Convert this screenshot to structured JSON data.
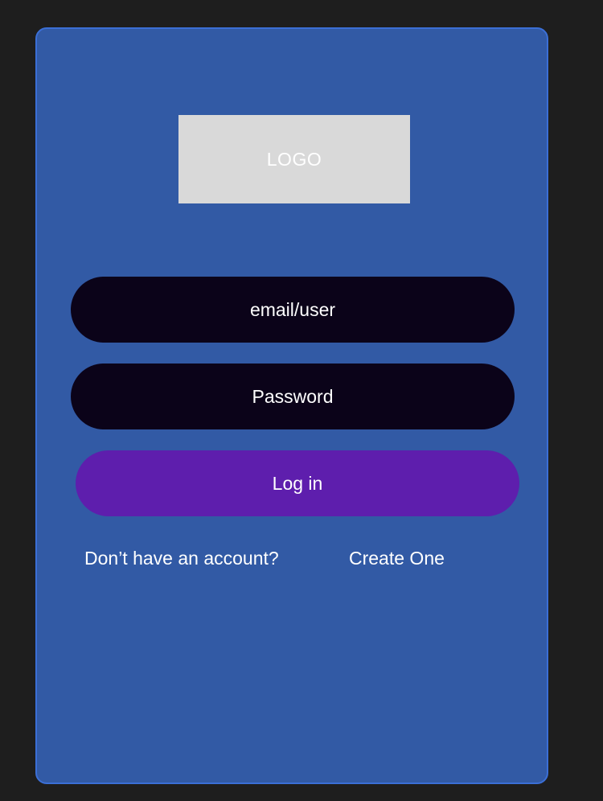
{
  "logo": {
    "text": "LOGO"
  },
  "form": {
    "email_placeholder": "email/user",
    "password_placeholder": "Password",
    "login_label": "Log in"
  },
  "footer": {
    "prompt": "Don’t have an account?",
    "create_link": "Create One"
  },
  "colors": {
    "background": "#1e1e1e",
    "card": "#325aa5",
    "card_border": "#3b6fd6",
    "logo_placeholder": "#d9d9d9",
    "input_bg": "#0b0319",
    "login_button": "#5e1ead",
    "text": "#ffffff"
  }
}
